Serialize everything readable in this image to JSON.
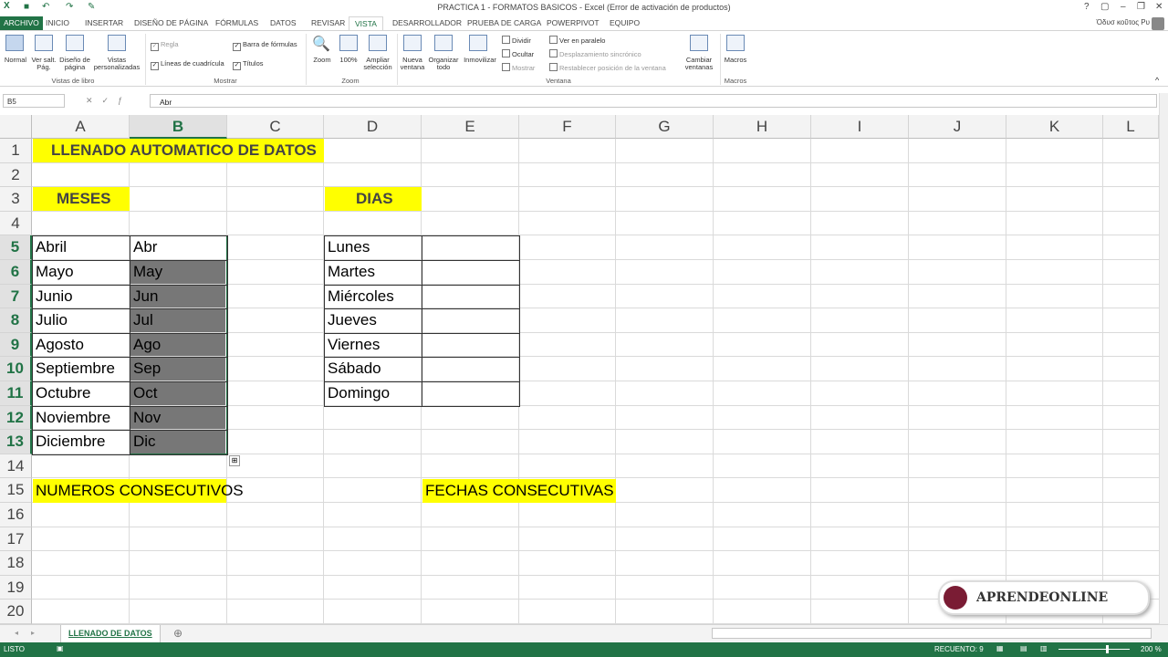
{
  "window": {
    "title": "PRACTICA 1 - FORMATOS BASICOS - Excel (Error de activación de productos)",
    "user": "Ὀδυσ κοῦτος Ρυ"
  },
  "tabs": [
    "ARCHIVO",
    "INICIO",
    "INSERTAR",
    "DISEÑO DE PÁGINA",
    "FÓRMULAS",
    "DATOS",
    "REVISAR",
    "VISTA",
    "DESARROLLADOR",
    "PRUEBA DE CARGA",
    "POWERPIVOT",
    "EQUIPO"
  ],
  "ribbon": {
    "vistas": [
      "Normal",
      "Ver salt. Pág.",
      "Diseño de página",
      "Vistas personalizadas"
    ],
    "vistas_group": "Vistas de libro",
    "mostrar": [
      "Regla",
      "Barra de fórmulas",
      "Líneas de cuadrícula",
      "Títulos"
    ],
    "mostrar_group": "Mostrar",
    "zoom": [
      "Zoom",
      "100%",
      "Ampliar selección"
    ],
    "zoom_group": "Zoom",
    "ventana": [
      "Nueva ventana",
      "Organizar todo",
      "Inmovilizar"
    ],
    "ventana_small": [
      "Dividir",
      "Ocultar",
      "Mostrar"
    ],
    "ventana_small2": [
      "Ver en paralelo",
      "Desplazamiento sincrónico",
      "Restablecer posición de la ventana"
    ],
    "cambiar": "Cambiar ventanas",
    "ventana_group": "Ventana",
    "macros": "Macros",
    "macros_group": "Macros"
  },
  "formula_bar": {
    "name_box": "B5",
    "value": "Abr"
  },
  "columns": [
    "A",
    "B",
    "C",
    "D",
    "E",
    "F",
    "G",
    "H",
    "I",
    "J",
    "K",
    "L"
  ],
  "rows": [
    "1",
    "2",
    "3",
    "4",
    "5",
    "6",
    "7",
    "8",
    "9",
    "10",
    "11",
    "12",
    "13",
    "14",
    "15",
    "16",
    "17",
    "18",
    "19",
    "20"
  ],
  "cells": {
    "title": "LLENADO AUTOMATICO DE DATOS",
    "meses_header": "MESES",
    "dias_header": "DIAS",
    "meses": [
      "Abril",
      "Mayo",
      "Junio",
      "Julio",
      "Agosto",
      "Septiembre",
      "Octubre",
      "Noviembre",
      "Diciembre"
    ],
    "meses_abrev": [
      "Abr",
      "May",
      "Jun",
      "Jul",
      "Ago",
      "Sep",
      "Oct",
      "Nov",
      "Dic"
    ],
    "dias": [
      "Lunes",
      "Martes",
      "Miércoles",
      "Jueves",
      "Viernes",
      "Sábado",
      "Domingo"
    ],
    "numeros": "NUMEROS CONSECUTIVOS",
    "fechas": "FECHAS CONSECUTIVAS"
  },
  "sheet_tab": "LLENADO DE DATOS",
  "status": {
    "mode": "LISTO",
    "count": "RECUENTO: 9",
    "zoom": "200 %"
  },
  "watermark": "APRENDEONLINE",
  "colors": {
    "excel_green": "#217346",
    "highlight": "#ffff00",
    "selection_fill": "#777777"
  }
}
